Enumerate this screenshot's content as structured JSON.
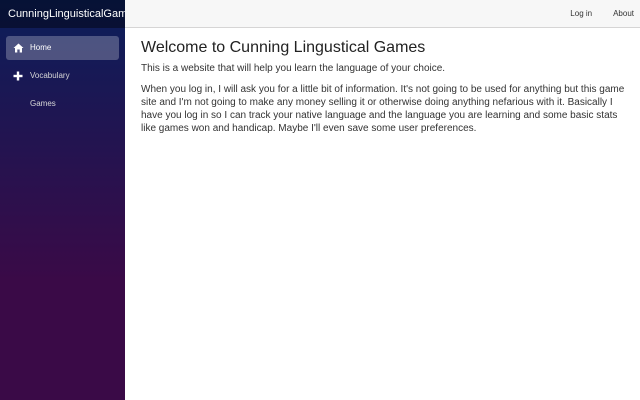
{
  "sidebar": {
    "brand": "CunningLinguisticalGames",
    "items": [
      {
        "label": "Home",
        "icon": "home-icon",
        "active": true
      },
      {
        "label": "Vocabulary",
        "icon": "plus-icon",
        "active": false
      },
      {
        "label": "Games",
        "icon": "",
        "active": false
      }
    ]
  },
  "topbar": {
    "login": "Log in",
    "about": "About"
  },
  "main": {
    "title": "Welcome to Cunning Lingustical Games",
    "intro": "This is a website that will help you learn the language of your choice.",
    "body": "When you log in, I will ask you for a little bit of information. It's not going to be used for anything but this game site and I'm not going to make any money selling it or otherwise doing anything nefarious with it. Basically I have you log in so I can track your native language and the language you are learning and some basic stats like games won and handicap. Maybe I'll even save some user preferences."
  },
  "colors": {
    "sidebar_top": "#0b1e5a",
    "sidebar_bottom": "#3a0a47",
    "topbar_bg": "#f7f7f7"
  }
}
